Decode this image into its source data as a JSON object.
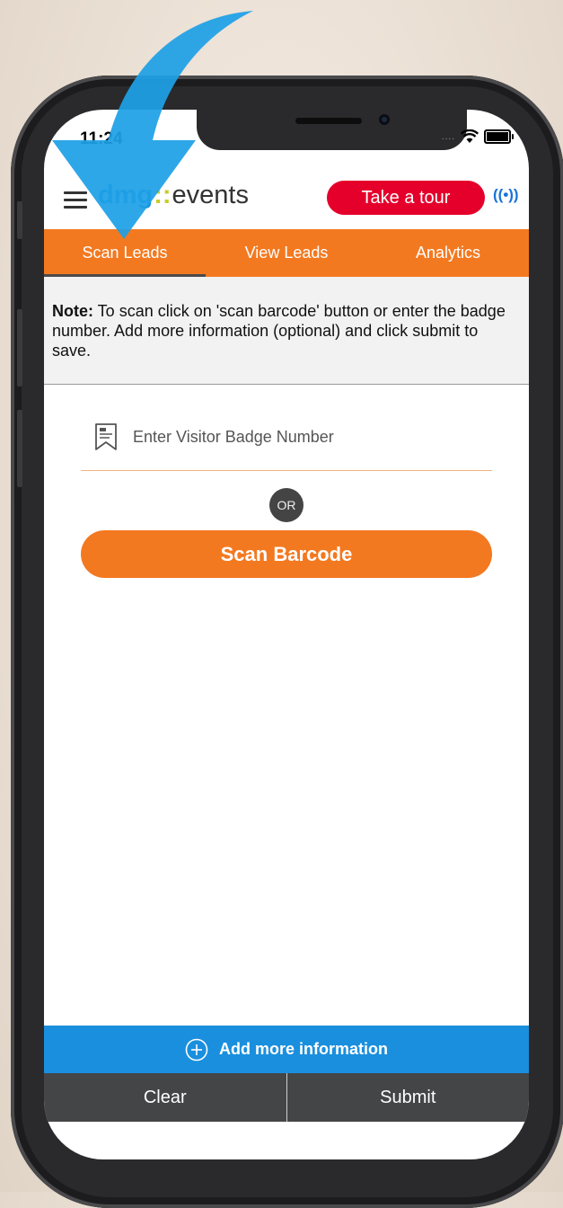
{
  "status_bar": {
    "time": "11:24"
  },
  "header": {
    "logo": {
      "dmg": "dmg",
      "dots": "::",
      "events": "events"
    },
    "tour_label": "Take a tour",
    "live_icon_text": "((•))"
  },
  "tabs": [
    {
      "label": "Scan Leads",
      "active": true
    },
    {
      "label": "View Leads",
      "active": false
    },
    {
      "label": "Analytics",
      "active": false
    }
  ],
  "note": {
    "prefix": "Note:",
    "text": " To scan click on 'scan barcode' button or enter the badge number. Add more information (optional) and click submit to save."
  },
  "badge": {
    "placeholder": "Enter Visitor Badge Number",
    "value": ""
  },
  "or_label": "OR",
  "scan_label": "Scan Barcode",
  "add_info_label": "Add more information",
  "footer": {
    "clear_label": "Clear",
    "submit_label": "Submit"
  },
  "colors": {
    "orange": "#f37920",
    "blue": "#1a8fde",
    "red": "#e4002b",
    "dark": "#434547",
    "arrow": "#1ea0e6"
  },
  "icons": [
    "hamburger-icon",
    "live-broadcast-icon",
    "badge-icon",
    "plus-circle-icon",
    "wifi-icon",
    "battery-icon",
    "arrow-pointer-icon"
  ]
}
